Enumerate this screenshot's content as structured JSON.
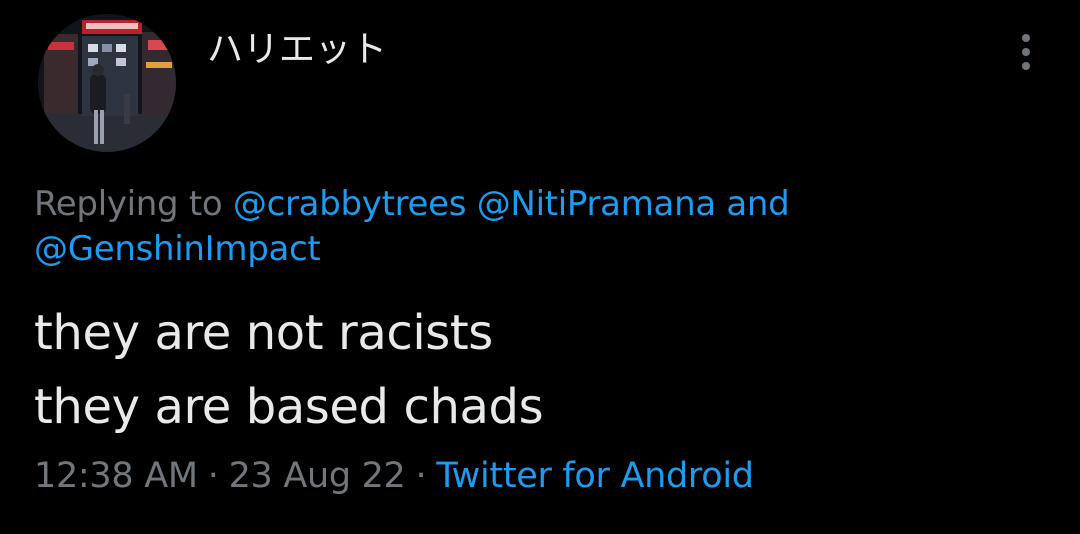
{
  "author": {
    "display_name": "ハリエット",
    "avatar": "avatar-photo"
  },
  "more_icon": "more-vertical-icon",
  "reply_context": {
    "prefix": "Replying to",
    "mentions": [
      "@crabbytrees",
      "@NitiPramana",
      "@GenshinImpact"
    ],
    "conjunction": "and"
  },
  "tweet": {
    "lines": [
      "they are not racists",
      "they are based chads"
    ]
  },
  "meta": {
    "time": "12:38 AM",
    "separator": "·",
    "date": "23 Aug 22",
    "source": "Twitter for Android"
  },
  "colors": {
    "background": "#000000",
    "text": "#e7e9ea",
    "secondary": "#71767b",
    "accent": "#1d9bf0"
  }
}
